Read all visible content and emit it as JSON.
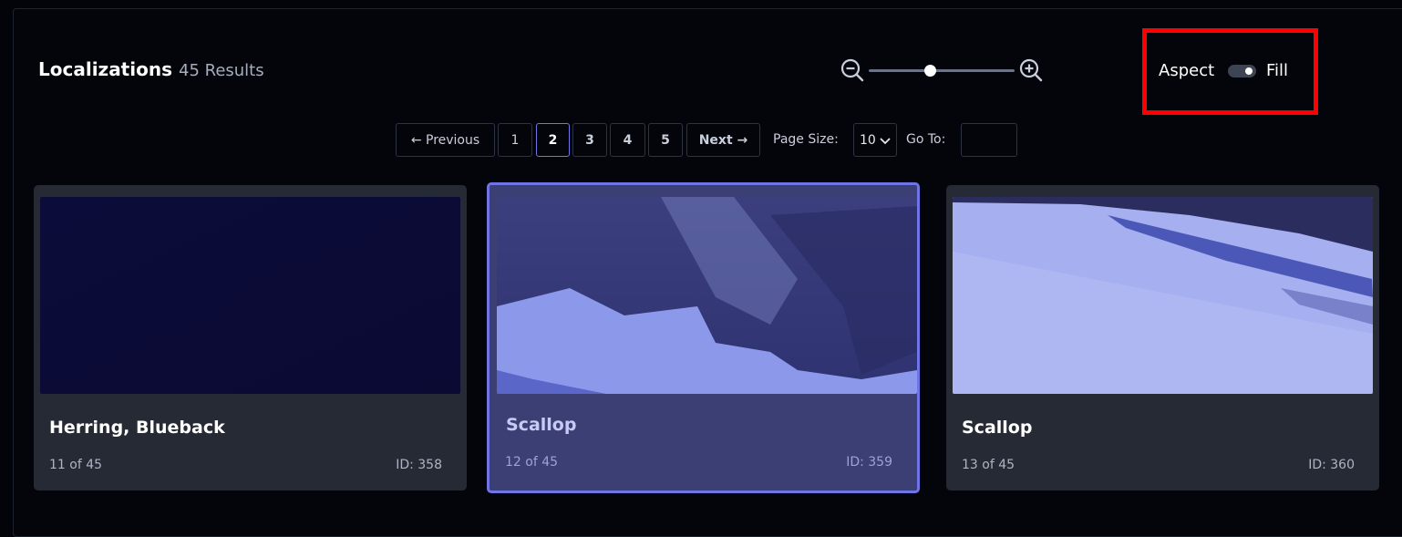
{
  "header": {
    "title": "Localizations",
    "results": "45 Results"
  },
  "zoom": {
    "zoom_out_icon": "zoom-out-icon",
    "zoom_in_icon": "zoom-in-icon",
    "level_fraction": 0.42
  },
  "view_toggle": {
    "left_label": "Aspect",
    "right_label": "Fill",
    "state": "Fill"
  },
  "pagination": {
    "previous": "← Previous",
    "pages": [
      "1",
      "2",
      "3",
      "4",
      "5"
    ],
    "current_page": "2",
    "next": "Next →",
    "page_size_label": "Page Size:",
    "page_size_value": "10",
    "goto_label": "Go To:",
    "goto_value": ""
  },
  "cards": [
    {
      "title": "Herring, Blueback",
      "count": "11 of 45",
      "id": "ID: 358",
      "selected": false
    },
    {
      "title": "Scallop",
      "count": "12 of 45",
      "id": "ID: 359",
      "selected": true
    },
    {
      "title": "Scallop",
      "count": "13 of 45",
      "id": "ID: 360",
      "selected": false
    }
  ],
  "colors": {
    "background": "#03050a",
    "card": "#262a35",
    "card_selected": "#3c3f74",
    "accent": "#6f74e6",
    "highlight": "#ff0000"
  }
}
